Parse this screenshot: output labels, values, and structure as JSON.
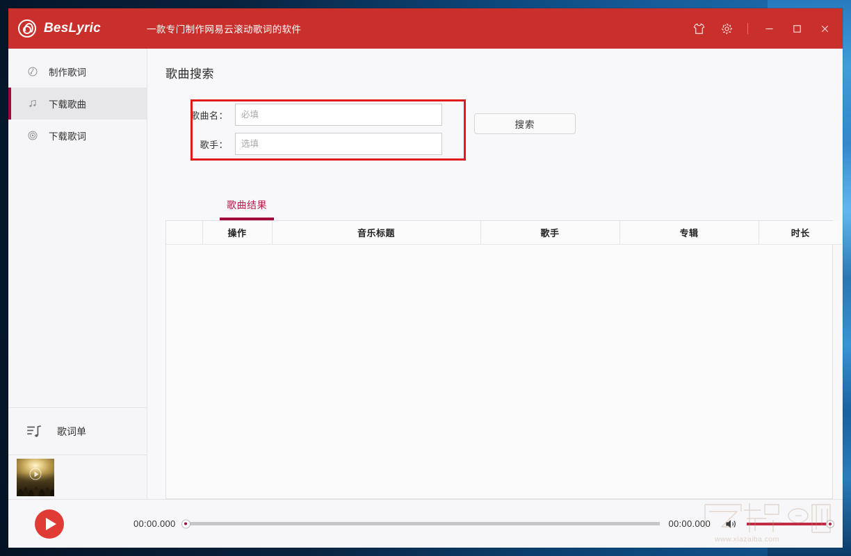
{
  "window": {
    "app_name": "BesLyric",
    "slogan": "一款专门制作网易云滚动歌词的软件",
    "logo_icon": "netease-cloud-music-logo-icon"
  },
  "titlebar": {
    "skin_icon": "t-shirt-icon",
    "skin_label": "换肤",
    "settings_icon": "gear-icon",
    "settings_label": "设置",
    "minimize_label": "最小化",
    "maximize_label": "最大化",
    "close_label": "关闭"
  },
  "sidebar": {
    "items": [
      {
        "label": "制作歌词",
        "icon": "lyric-pen-icon",
        "active": false
      },
      {
        "label": "下载歌曲",
        "icon": "music-note-icon",
        "active": true
      },
      {
        "label": "下载歌词",
        "icon": "radio-wave-icon",
        "active": false
      }
    ],
    "lyric_list": {
      "label": "歌词单",
      "icon": "playlist-note-icon"
    },
    "album_art": {
      "alt": "演唱会人群封面",
      "play_icon": "play-circle-icon"
    }
  },
  "main": {
    "page_title": "歌曲搜索",
    "search": {
      "song_label": "歌曲名：",
      "song_value": "",
      "song_placeholder": "必填",
      "artist_label": "歌手：",
      "artist_value": "",
      "artist_placeholder": "选填",
      "search_button": "搜索",
      "annotation_color": "#e01b1b"
    },
    "tabs": [
      {
        "label": "歌曲结果",
        "active": true
      }
    ],
    "table": {
      "columns": [
        "",
        "操作",
        "音乐标题",
        "歌手",
        "专辑",
        "时长"
      ],
      "rows": []
    }
  },
  "player": {
    "play_icon": "play-icon",
    "current_time": "00:00.000",
    "total_time": "00:00.000",
    "progress_percent": 0,
    "volume_icon": "speaker-icon",
    "volume_percent": 100
  },
  "watermark": {
    "text": "下载吧",
    "url": "www.xiazaiba.com"
  },
  "colors": {
    "header_red": "#c9302c",
    "accent_crimson": "#a3083c",
    "annotation_red": "#e01b1b",
    "play_red": "#e03b35"
  }
}
